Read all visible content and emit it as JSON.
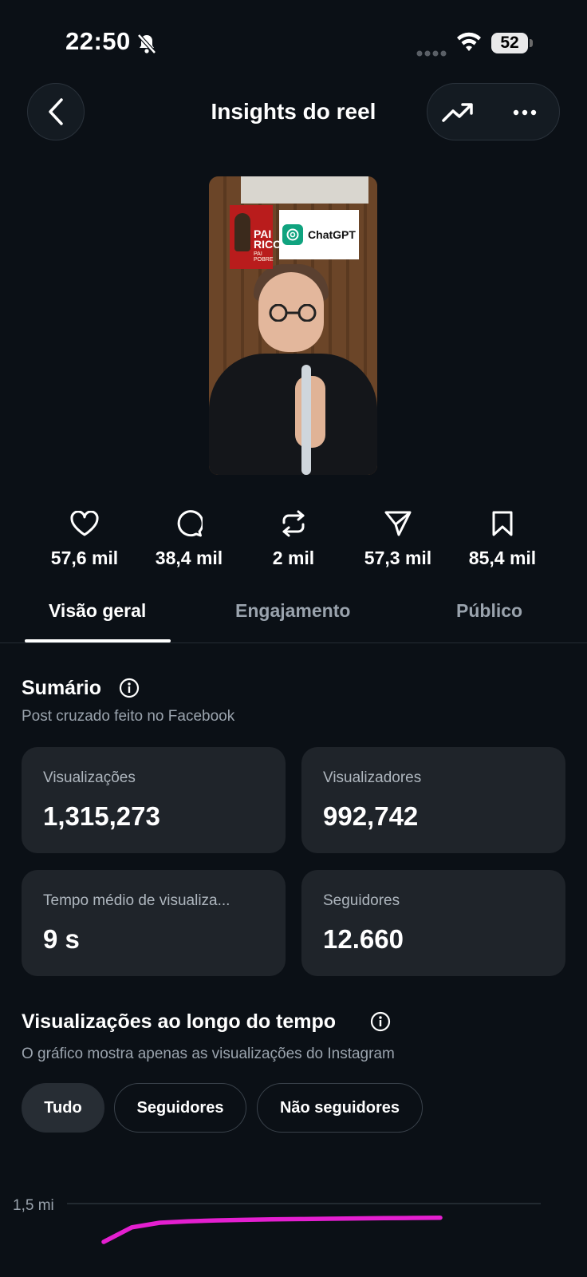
{
  "status_bar": {
    "time": "22:50",
    "battery": "52"
  },
  "header": {
    "title": "Insights do reel"
  },
  "thumbnail": {
    "book_title": "PAI RICO",
    "book_subtitle": "PAI POBRE",
    "overlay_label": "ChatGPT"
  },
  "stats": [
    {
      "icon": "heart-icon",
      "value": "57,6 mil"
    },
    {
      "icon": "comment-icon",
      "value": "38,4 mil"
    },
    {
      "icon": "repost-icon",
      "value": "2 mil"
    },
    {
      "icon": "share-icon",
      "value": "57,3 mil"
    },
    {
      "icon": "bookmark-icon",
      "value": "85,4 mil"
    }
  ],
  "tabs": [
    {
      "label": "Visão geral",
      "active": true
    },
    {
      "label": "Engajamento",
      "active": false
    },
    {
      "label": "Público",
      "active": false
    }
  ],
  "summary": {
    "title": "Sumário",
    "subtitle": "Post cruzado feito no Facebook",
    "cards": [
      {
        "label": "Visualizações",
        "value": "1,315,273"
      },
      {
        "label": "Visualizadores",
        "value": "992,742"
      },
      {
        "label": "Tempo médio de visualiza...",
        "value": "9 s"
      },
      {
        "label": "Seguidores",
        "value": "12.660"
      }
    ]
  },
  "views_over_time": {
    "title": "Visualizações ao longo do tempo",
    "subtitle": "O gráfico mostra apenas as visualizações do Instagram",
    "filters": [
      {
        "label": "Tudo",
        "selected": true
      },
      {
        "label": "Seguidores",
        "selected": false
      },
      {
        "label": "Não seguidores",
        "selected": false
      }
    ]
  },
  "chart_data": {
    "type": "line",
    "y_tick_labels": [
      "1,5 mi"
    ],
    "ylim": [
      0,
      1500000
    ],
    "series_color": "#e41fd0",
    "series": [
      {
        "x": [
          0,
          1,
          2,
          3,
          4,
          5,
          6,
          7,
          8,
          9,
          10,
          11,
          12
        ],
        "y": [
          1000000,
          1190000,
          1250000,
          1268000,
          1280000,
          1288000,
          1294000,
          1298000,
          1302000,
          1306000,
          1309000,
          1312000,
          1315273
        ]
      }
    ]
  },
  "colors": {
    "background": "#0b1016",
    "card": "#1f242a",
    "accent_line": "#e41fd0"
  }
}
